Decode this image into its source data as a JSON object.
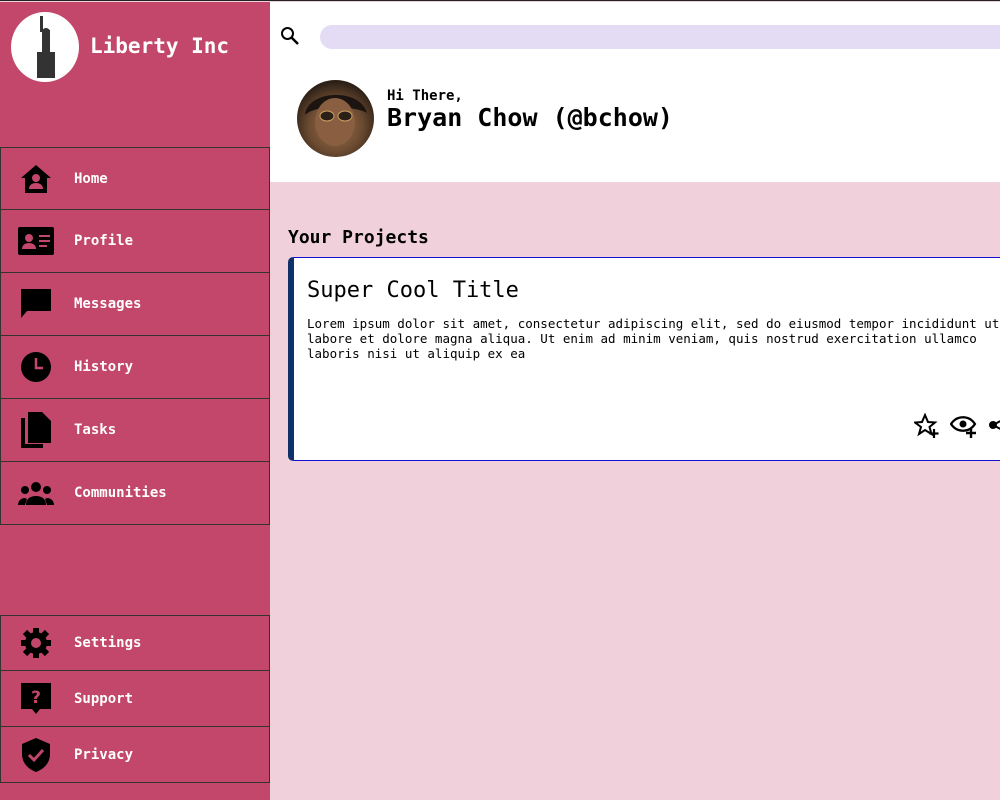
{
  "brand": {
    "name": "Liberty Inc",
    "logo": "statue-of-liberty-logo"
  },
  "nav": [
    {
      "label": "Home",
      "icon": "home-icon"
    },
    {
      "label": "Profile",
      "icon": "id-card-icon"
    },
    {
      "label": "Messages",
      "icon": "chat-icon"
    },
    {
      "label": "History",
      "icon": "clock-icon"
    },
    {
      "label": "Tasks",
      "icon": "documents-icon"
    },
    {
      "label": "Communities",
      "icon": "people-icon"
    }
  ],
  "nav_bottom": [
    {
      "label": "Settings",
      "icon": "gear-icon"
    },
    {
      "label": "Support",
      "icon": "help-icon"
    },
    {
      "label": "Privacy",
      "icon": "shield-icon"
    }
  ],
  "header": {
    "search_placeholder": "",
    "greeting": "Hi There,",
    "user": "Bryan Chow (@bchow)"
  },
  "projects": {
    "heading": "Your Projects",
    "cards": [
      {
        "title": "Super Cool Title",
        "body": "Lorem ipsum dolor sit amet, consectetur adipiscing elit, sed do eiusmod tempor incididunt ut labore et dolore magna aliqua. Ut enim ad minim veniam, quis nostrud exercitation ullamco laboris nisi ut aliquip ex ea"
      }
    ]
  },
  "colors": {
    "sidebar": "#c2476a",
    "background": "#f0d0da",
    "search": "#e4dcf4",
    "card_accent": "#10306a"
  }
}
